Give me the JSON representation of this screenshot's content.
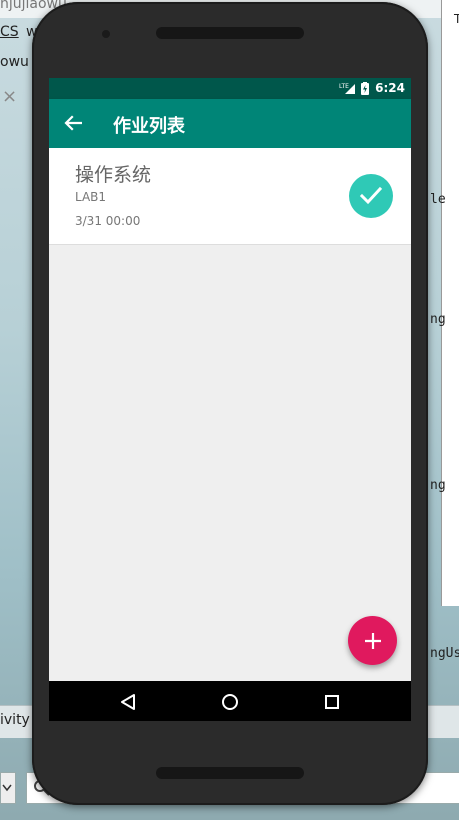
{
  "desktop": {
    "top_text": "njujiaowu",
    "menu_cs": "CS",
    "menu_w": "w",
    "row2_text": "owu",
    "tab_close": "×",
    "right_snippets": [
      "T",
      "le",
      "ng",
      "ng",
      "ngUs"
    ],
    "bottom_text": "ivity"
  },
  "status_bar": {
    "network": "LTE",
    "time": "6:24"
  },
  "app_bar": {
    "title": "作业列表",
    "back_icon": "arrow-back-icon"
  },
  "assignments": [
    {
      "course": "操作系统",
      "lab": "LAB1",
      "deadline": "3/31 00:00",
      "completed": true
    }
  ],
  "colors": {
    "status_bar": "#00574b",
    "app_bar": "#008577",
    "check_badge": "#2fc9b6",
    "fab": "#e0195e"
  },
  "fab": {
    "icon": "plus-icon"
  },
  "nav_bar": {
    "back": "triangle-back-icon",
    "home": "circle-home-icon",
    "recents": "square-recents-icon"
  }
}
